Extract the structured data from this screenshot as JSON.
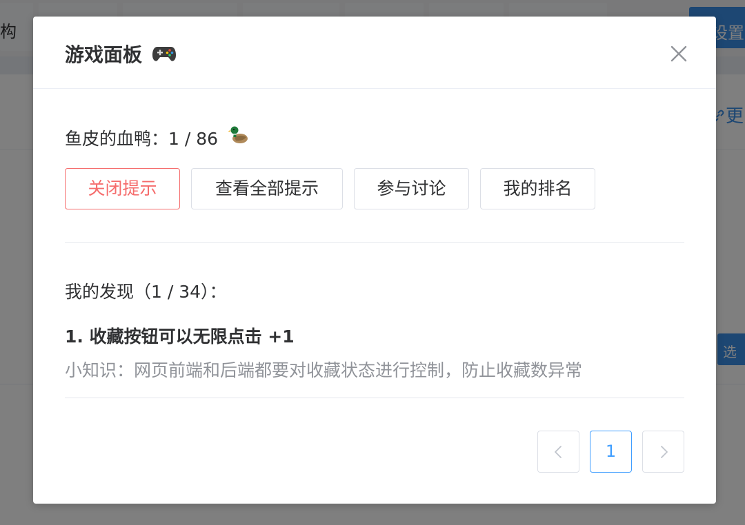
{
  "background": {
    "topbar_fragment": "构",
    "settings_label": "设置",
    "more_label": "更",
    "select_label": "选"
  },
  "dialog": {
    "title": "游戏面板",
    "title_icon": "gamepad-icon",
    "close_icon": "close-icon",
    "score_text": "鱼皮的血鸭：1 / 86",
    "score_icon": "duck-icon",
    "buttons": {
      "close_hint": "关闭提示",
      "view_all_hints": "查看全部提示",
      "join_discussion": "参与讨论",
      "my_ranking": "我的排名"
    },
    "discoveries_title": "我的发现（1 / 34）：",
    "items": [
      {
        "title": "1. 收藏按钮可以无限点击 +1",
        "tip": "小知识：网页前端和后端都要对收藏状态进行控制，防止收藏数异常"
      }
    ],
    "pagination": {
      "prev_icon": "chevron-left-icon",
      "current_page": "1",
      "next_icon": "chevron-right-icon"
    }
  },
  "colors": {
    "danger": "#f56c6c",
    "primary": "#409eff",
    "text_primary": "#303133",
    "text_secondary": "#909399",
    "border": "#dcdfe6",
    "overlay": "rgba(0,0,0,0.5)"
  }
}
